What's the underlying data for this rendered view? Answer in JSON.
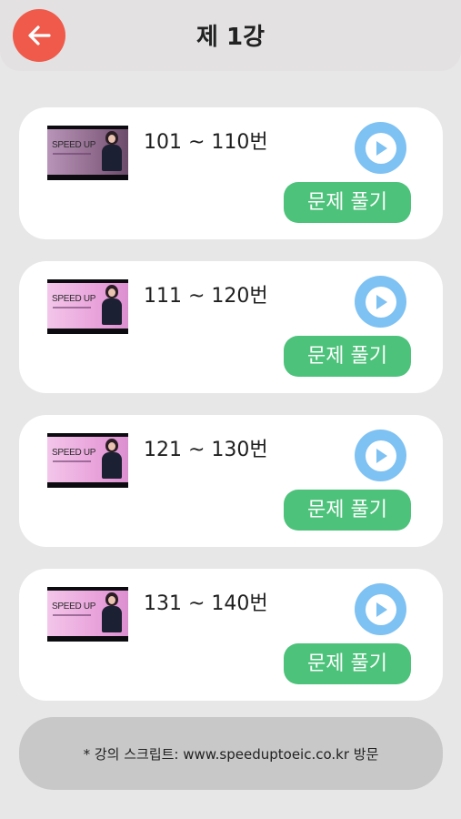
{
  "header": {
    "title": "제 1강",
    "back_icon": "arrow-left-icon",
    "back_color": "#ef5a4a"
  },
  "lessons": [
    {
      "range": "101 ~ 110번",
      "thumb_title": "SPEED UP",
      "solve_label": "문제 풀기"
    },
    {
      "range": "111 ~ 120번",
      "thumb_title": "SPEED UP",
      "solve_label": "문제 풀기"
    },
    {
      "range": "121 ~ 130번",
      "thumb_title": "SPEED UP",
      "solve_label": "문제 풀기"
    },
    {
      "range": "131 ~ 140번",
      "thumb_title": "SPEED UP",
      "solve_label": "문제 풀기"
    }
  ],
  "play_icon": "play-icon",
  "footer": {
    "text": "* 강의 스크립트: www.speeduptoeic.co.kr 방문"
  },
  "colors": {
    "accent_green": "#4cc27a",
    "play_blue": "#7ec1f3",
    "background": "#e8e7e8"
  }
}
